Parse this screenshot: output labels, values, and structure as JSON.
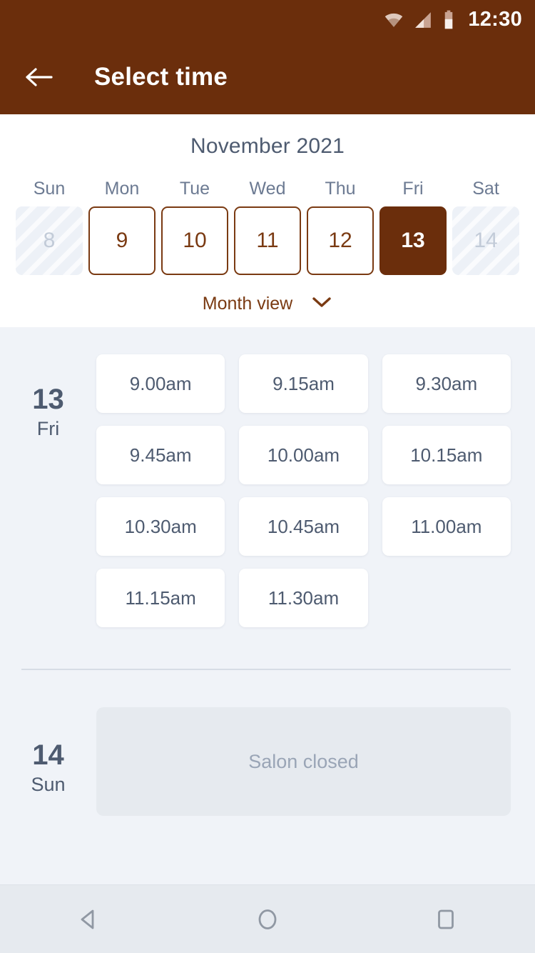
{
  "status_bar": {
    "time": "12:30",
    "icons": [
      "wifi-icon",
      "cellular-signal-icon",
      "battery-icon"
    ]
  },
  "app_bar": {
    "back_icon": "back-arrow-icon",
    "title": "Select time"
  },
  "calendar": {
    "month_title": "November 2021",
    "weekdays": [
      "Sun",
      "Mon",
      "Tue",
      "Wed",
      "Thu",
      "Fri",
      "Sat"
    ],
    "days": [
      {
        "label": "8",
        "state": "disabled"
      },
      {
        "label": "9",
        "state": "available"
      },
      {
        "label": "10",
        "state": "available"
      },
      {
        "label": "11",
        "state": "available"
      },
      {
        "label": "12",
        "state": "available"
      },
      {
        "label": "13",
        "state": "selected"
      },
      {
        "label": "14",
        "state": "disabled"
      }
    ],
    "view_toggle": {
      "label": "Month view",
      "chevron_icon": "chevron-down-icon"
    }
  },
  "schedule": [
    {
      "day_number": "13",
      "day_of_week": "Fri",
      "type": "slots",
      "slots": [
        "9.00am",
        "9.15am",
        "9.30am",
        "9.45am",
        "10.00am",
        "10.15am",
        "10.30am",
        "10.45am",
        "11.00am",
        "11.15am",
        "11.30am"
      ]
    },
    {
      "day_number": "14",
      "day_of_week": "Sun",
      "type": "closed",
      "closed_message": "Salon closed"
    }
  ],
  "nav_bar": {
    "back": "nav-back-icon",
    "home": "nav-home-icon",
    "recents": "nav-recents-icon"
  },
  "theme": {
    "brand_brown": "#6B2E0C",
    "brand_brown_border": "#7A3A12",
    "slate": "#4E5B70",
    "page_bg": "#F0F3F8",
    "closed_bg": "#E6EAEF"
  }
}
